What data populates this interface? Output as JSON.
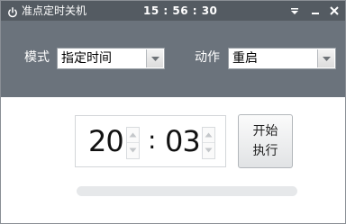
{
  "window": {
    "title": "准点定时关机",
    "clock": "15 : 56 : 30",
    "icon": "power-icon"
  },
  "controls": {
    "mode_label": "模式",
    "mode_value": "指定时间",
    "action_label": "动作",
    "action_value": "重启"
  },
  "timer": {
    "hours": "20",
    "separator": ":",
    "minutes": "03"
  },
  "execute_button": {
    "line1": "开始",
    "line2": "执行"
  },
  "progress": {
    "fraction": 0
  },
  "colors": {
    "titlebar": "#545b62",
    "band": "#6b737c",
    "progress_track": "#e6e8ea"
  }
}
